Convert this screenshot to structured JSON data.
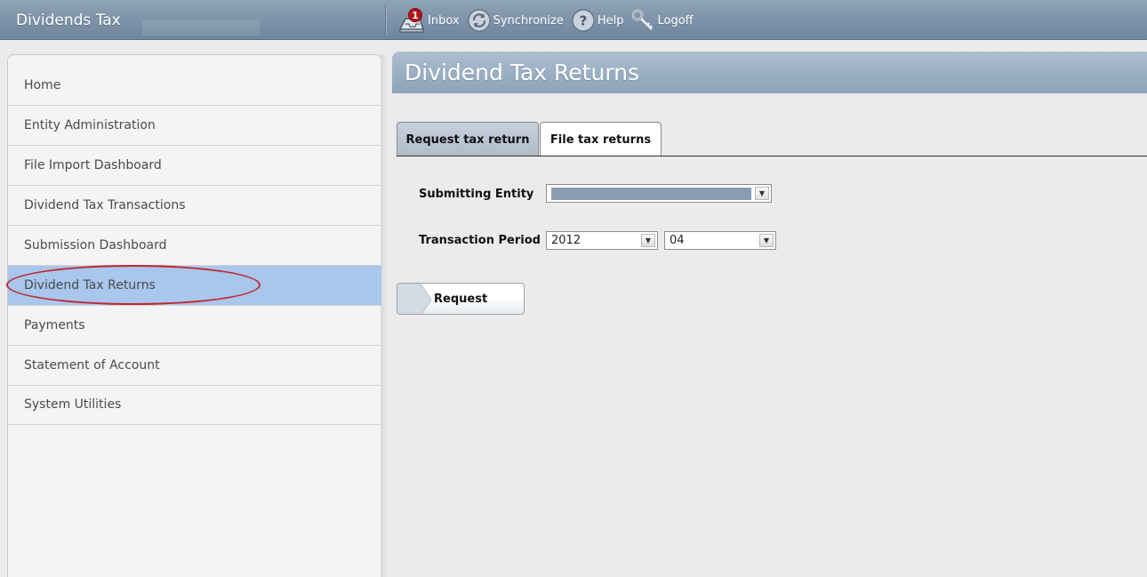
{
  "app": {
    "title": "Dividends Tax"
  },
  "toolbar": {
    "inbox_label": "Inbox",
    "inbox_badge": "1",
    "sync_label": "Synchronize",
    "help_label": "Help",
    "logoff_label": "Logoff"
  },
  "sidebar": {
    "items": [
      {
        "label": "Home"
      },
      {
        "label": "Entity Administration"
      },
      {
        "label": "File Import Dashboard"
      },
      {
        "label": "Dividend Tax Transactions"
      },
      {
        "label": "Submission Dashboard"
      },
      {
        "label": "Dividend Tax Returns"
      },
      {
        "label": "Payments"
      },
      {
        "label": "Statement of Account"
      },
      {
        "label": "System Utilities"
      }
    ],
    "active_index": 5
  },
  "main": {
    "title": "Dividend Tax Returns",
    "tabs": [
      {
        "label": "Request tax return",
        "selected": true
      },
      {
        "label": "File tax returns",
        "selected": false
      }
    ],
    "form": {
      "entity_label": "Submitting Entity",
      "entity_value": "",
      "period_label": "Transaction Period",
      "year_value": "2012",
      "month_value": "04"
    },
    "request_label": "Request"
  },
  "colors": {
    "topbar": "#7d92a8",
    "active_nav": "#a9c6ec",
    "highlight": "#c0272d",
    "badge": "#b3131b"
  },
  "icons": [
    "inbox-icon",
    "sync-icon",
    "help-icon",
    "logoff-icon",
    "chevron-down-icon"
  ]
}
